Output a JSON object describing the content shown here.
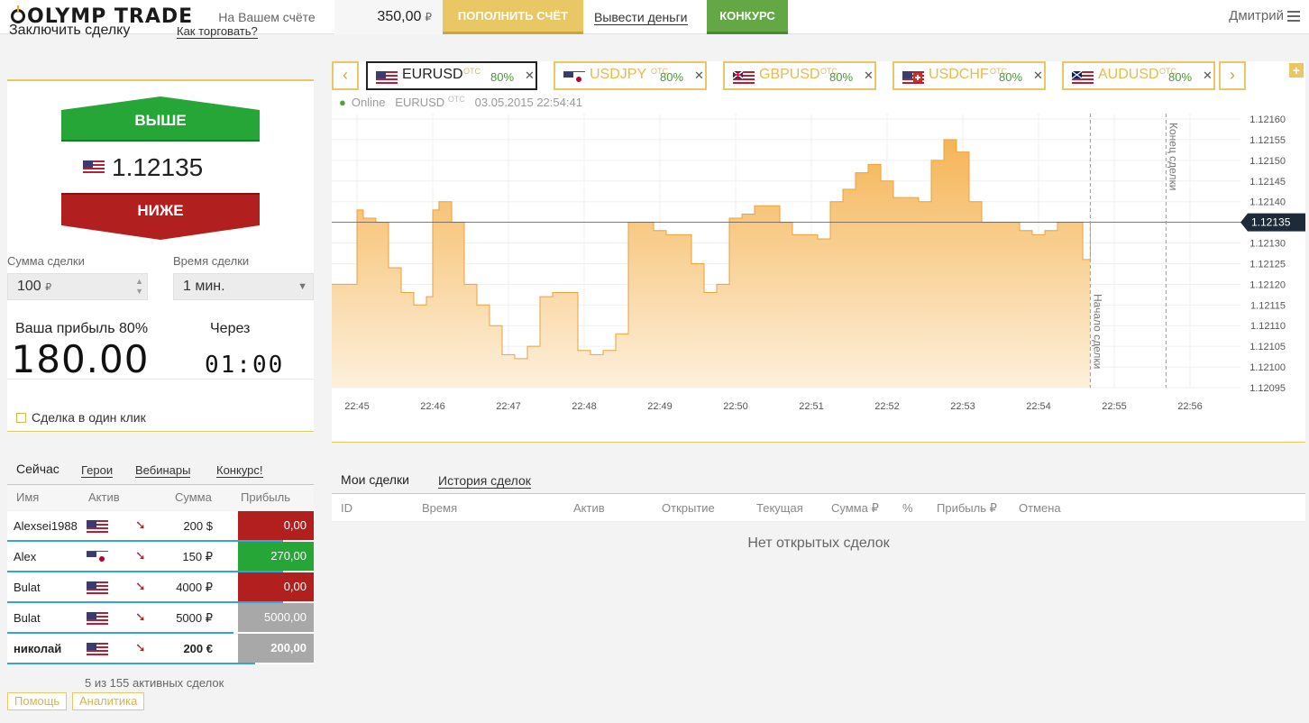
{
  "header": {
    "logo": "OLYMP TRADE",
    "account_label": "На Вашем счёте",
    "balance": "350,00",
    "currency": "₽",
    "deposit_label": "ПОПОЛНИТЬ СЧЁТ",
    "withdraw_label": "Вывести деньги",
    "contest_label": "КОНКУРС",
    "user_name": "Дмитрий"
  },
  "deal": {
    "title": "Заключить сделку",
    "how_to_trade": "Как торговать?",
    "up_label": "ВЫШЕ",
    "down_label": "НИЖЕ",
    "current_price": "1.12135",
    "sum_label": "Сумма сделки",
    "sum_value": "100",
    "sum_currency": "₽",
    "time_label": "Время сделки",
    "time_value": "1 мин.",
    "profit_label": "Ваша прибыль 80%",
    "profit_value": "180.00",
    "through_label": "Через",
    "through_value": "01:00",
    "one_click_label": "Сделка в один клик"
  },
  "now": {
    "tabs": [
      "Сейчас",
      "Герои",
      "Вебинары",
      "Конкурс!"
    ],
    "columns": [
      "Имя",
      "Актив",
      "Сумма",
      "Прибыль"
    ],
    "rows": [
      {
        "name": "Alexsei1988",
        "flag": "us",
        "direction": "down",
        "sum": "200 $",
        "profit": "0,00",
        "profit_color": "#b21f1f",
        "underline": 1.0,
        "bold": false
      },
      {
        "name": "Alex",
        "flag": "jp",
        "direction": "down",
        "sum": "150 ₽",
        "profit": "270,00",
        "profit_color": "#26a637",
        "underline": 1.0,
        "bold": false
      },
      {
        "name": "Bulat",
        "flag": "us",
        "direction": "down",
        "sum": "4000 ₽",
        "profit": "0,00",
        "profit_color": "#b21f1f",
        "underline": 1.0,
        "bold": false
      },
      {
        "name": "Bulat",
        "flag": "us",
        "direction": "down",
        "sum": "5000 ₽",
        "profit": "5000,00",
        "profit_color": "#a8a8a8",
        "underline": 0.82,
        "bold": false
      },
      {
        "name": "николай",
        "flag": "us",
        "direction": "down",
        "sum": "200 €",
        "profit": "200,00",
        "profit_color": "#a8a8a8",
        "underline": 0.9,
        "bold": true
      }
    ],
    "count_text": "5 из 155 активных сделок",
    "footer_tabs": [
      "Помощь",
      "Аналитика"
    ]
  },
  "chart_tabs": [
    {
      "symbol": "EURUSD",
      "otc": "OTC",
      "pct": "80%",
      "flag": "eu",
      "active": true
    },
    {
      "symbol": "USDJPY",
      "otc": "OTC",
      "pct": "80%",
      "flag": "jp",
      "active": false
    },
    {
      "symbol": "GBPUSD",
      "otc": "OTC",
      "pct": "80%",
      "flag": "gb",
      "active": false
    },
    {
      "symbol": "USDCHF",
      "otc": "OTC",
      "pct": "80%",
      "flag": "ch",
      "active": false
    },
    {
      "symbol": "AUDUSD",
      "otc": "OTC",
      "pct": "80%",
      "flag": "au",
      "active": false
    }
  ],
  "status": {
    "online": "Online",
    "symbol": "EURUSD",
    "otc": "OTC",
    "datetime": "03.05.2015 22:54:41"
  },
  "chart_data": {
    "type": "area",
    "series": [
      {
        "x": [
          "22:44:40",
          "22:44:50",
          "22:45:00",
          "22:45:05",
          "22:45:15",
          "22:45:25",
          "22:45:35",
          "22:45:45",
          "22:45:55",
          "22:46:00",
          "22:46:05",
          "22:46:15",
          "22:46:25",
          "22:46:35",
          "22:46:45",
          "22:46:55",
          "22:47:05",
          "22:47:15",
          "22:47:25",
          "22:47:35",
          "22:47:45",
          "22:47:55",
          "22:48:05",
          "22:48:15",
          "22:48:25",
          "22:48:35",
          "22:48:45",
          "22:48:55",
          "22:49:05",
          "22:49:15",
          "22:49:25",
          "22:49:35",
          "22:49:45",
          "22:49:55",
          "22:50:05",
          "22:50:15",
          "22:50:25",
          "22:50:35",
          "22:50:45",
          "22:50:55",
          "22:51:05",
          "22:51:15",
          "22:51:25",
          "22:51:35",
          "22:51:45",
          "22:51:55",
          "22:52:05",
          "22:52:15",
          "22:52:25",
          "22:52:35",
          "22:52:45",
          "22:52:55",
          "22:53:05",
          "22:53:15",
          "22:53:25",
          "22:53:35",
          "22:53:45",
          "22:53:55",
          "22:54:05",
          "22:54:15",
          "22:54:25",
          "22:54:35",
          "22:54:41"
        ],
        "values": [
          1.1212,
          1.1212,
          1.12138,
          1.12136,
          1.12135,
          1.12124,
          1.12118,
          1.12115,
          1.12117,
          1.12138,
          1.1214,
          1.12135,
          1.1212,
          1.12115,
          1.1211,
          1.12103,
          1.12102,
          1.12105,
          1.12117,
          1.12118,
          1.12118,
          1.12104,
          1.12103,
          1.12104,
          1.12108,
          1.12135,
          1.12135,
          1.12133,
          1.12132,
          1.12132,
          1.12125,
          1.12118,
          1.1212,
          1.12136,
          1.12137,
          1.12139,
          1.12139,
          1.12135,
          1.12132,
          1.12132,
          1.12131,
          1.1214,
          1.12143,
          1.12147,
          1.12149,
          1.12145,
          1.12141,
          1.12141,
          1.1214,
          1.1215,
          1.12155,
          1.12152,
          1.1214,
          1.12135,
          1.12135,
          1.12135,
          1.12133,
          1.12132,
          1.12133,
          1.12135,
          1.12135,
          1.12126,
          1.12135
        ]
      }
    ],
    "x_ticks": [
      "22:45",
      "22:46",
      "22:47",
      "22:48",
      "22:49",
      "22:50",
      "22:51",
      "22:52",
      "22:53",
      "22:54",
      "22:55",
      "22:56"
    ],
    "y_ticks": [
      "1.12160",
      "1.12155",
      "1.12150",
      "1.12145",
      "1.12140",
      "1.12135",
      "1.12130",
      "1.12125",
      "1.12120",
      "1.12115",
      "1.12110",
      "1.12105",
      "1.12100",
      "1.12095"
    ],
    "ylim": [
      1.12095,
      1.1216
    ],
    "xlim": [
      "22:44:40",
      "22:56:40"
    ],
    "current_price": "1.12135",
    "start_marker": {
      "time": "22:54:41",
      "label": "Начало сделки"
    },
    "end_marker": {
      "time": "22:55:41",
      "label": "Конец сделки"
    },
    "grid": true,
    "colors": {
      "fill_top": "#f5b556",
      "fill_bottom": "#fdf0dc",
      "line": "#eaa23a"
    }
  },
  "my_trades": {
    "tab_mine": "Мои сделки",
    "tab_history": "История сделок",
    "columns": [
      "ID",
      "Время",
      "Актив",
      "Открытие",
      "Текущая",
      "Сумма ₽",
      "%",
      "Прибыль ₽",
      "Отмена"
    ],
    "empty_text": "Нет открытых сделок"
  },
  "colors": {
    "accent": "#e8c764",
    "up": "#26a637",
    "down": "#b21f1f",
    "contest": "#63a845"
  }
}
